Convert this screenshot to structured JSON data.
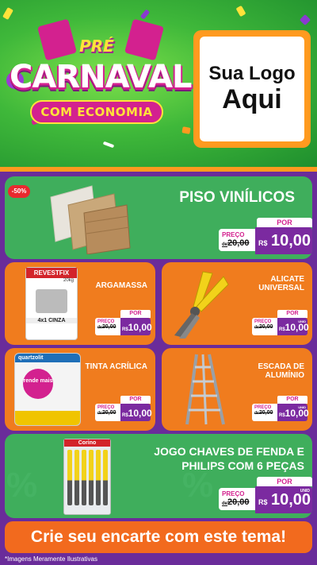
{
  "header": {
    "title_top": "PRÉ",
    "title_main": "CARNAVAL",
    "title_sub": "COM ECONOMIA",
    "logo_line1": "Sua Logo",
    "logo_line2": "Aqui"
  },
  "products": [
    {
      "name": "PISO VINÍLICOS",
      "discount": "-50%",
      "por": "POR",
      "preco_label": "PREÇO",
      "old_prefix": "de",
      "old_price": "20,00",
      "currency": "R$",
      "price": "10,00",
      "unit": ""
    },
    {
      "name": "ARGAMASSA",
      "por": "POR",
      "preco_label": "PREÇO",
      "old_prefix": "de",
      "old_price": "20,00",
      "currency": "R$",
      "price": "10,00",
      "unit": "",
      "image_text_brand": "REVESTFIX",
      "image_text_weight": "20kg",
      "image_text_type": "4x1 CINZA"
    },
    {
      "name": "ALICATE UNIVERSAL",
      "por": "POR",
      "preco_label": "PREÇO",
      "old_prefix": "de",
      "old_price": "20,00",
      "currency": "R$",
      "price": "10,00",
      "unit": "UNID"
    },
    {
      "name": "TINTA ACRÍLICA",
      "por": "POR",
      "preco_label": "PREÇO",
      "old_prefix": "de",
      "old_price": "20,00",
      "currency": "R$",
      "price": "10,00",
      "unit": "",
      "image_text_brand": "quartzolit",
      "image_text_tag": "rende mais"
    },
    {
      "name": "ESCADA DE ALUMÍNIO",
      "por": "POR",
      "preco_label": "PREÇO",
      "old_prefix": "de",
      "old_price": "20,00",
      "currency": "R$",
      "price": "10,00",
      "unit": "UNID"
    },
    {
      "name": "JOGO CHAVES DE FENDA E PHILIPS COM 6 PEÇAS",
      "por": "POR",
      "preco_label": "PREÇO",
      "old_prefix": "de",
      "old_price": "20,00",
      "currency": "R$",
      "price": "10,00",
      "unit": "UNID",
      "image_text_brand": "Corino"
    }
  ],
  "cta": "Crie seu encarte com este tema!",
  "footnote": "*Imagens Meramente Ilustrativas",
  "colors": {
    "green": "#3fae5c",
    "orange": "#f07c1e",
    "purple": "#6a2c9a",
    "magenta": "#d3218f",
    "price_bg": "#7b2aa0"
  }
}
